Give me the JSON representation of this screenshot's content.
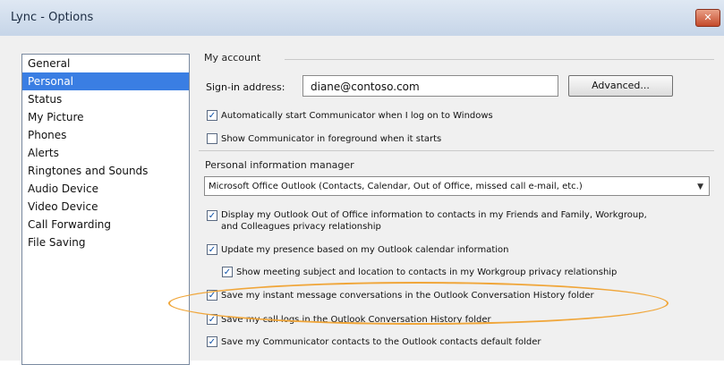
{
  "window": {
    "title": "Lync - Options",
    "close_label": "✕"
  },
  "nav": {
    "items": [
      {
        "label": "General",
        "selected": false
      },
      {
        "label": "Personal",
        "selected": true
      },
      {
        "label": "Status",
        "selected": false
      },
      {
        "label": "My Picture",
        "selected": false
      },
      {
        "label": "Phones",
        "selected": false
      },
      {
        "label": "Alerts",
        "selected": false
      },
      {
        "label": "Ringtones and Sounds",
        "selected": false
      },
      {
        "label": "Audio Device",
        "selected": false
      },
      {
        "label": "Video Device",
        "selected": false
      },
      {
        "label": "Call Forwarding",
        "selected": false
      },
      {
        "label": "File Saving",
        "selected": false
      }
    ]
  },
  "my_account": {
    "heading": "My account",
    "signin_label": "Sign-in address:",
    "signin_value": "diane@contoso.com",
    "advanced_label": "Advanced...",
    "auto_start": {
      "label": "Automatically start Communicator when I log on to Windows",
      "checked": true
    },
    "foreground": {
      "label": "Show Communicator in foreground when it starts",
      "checked": false
    }
  },
  "pim": {
    "heading": "Personal information manager",
    "dropdown_value": "Microsoft Office Outlook (Contacts, Calendar, Out of Office, missed call e-mail, etc.)",
    "options": [
      {
        "label": "Display my Outlook Out of Office information to contacts in my Friends and Family, Workgroup,",
        "label2": "and Colleagues privacy relationship",
        "checked": true
      },
      {
        "label": "Update my presence based on my Outlook calendar information",
        "checked": true
      },
      {
        "label": "Show meeting subject and location to contacts in my Workgroup privacy relationship",
        "checked": true
      },
      {
        "label": "Save my instant message conversations in the Outlook Conversation History folder",
        "checked": true
      },
      {
        "label": "Save my call logs in the Outlook Conversation History folder",
        "checked": true
      },
      {
        "label": "Save my Communicator contacts to the Outlook contacts default folder",
        "checked": true
      }
    ]
  },
  "colors": {
    "selected_bg": "#3a7ee3",
    "highlight": "#f0a63a"
  }
}
